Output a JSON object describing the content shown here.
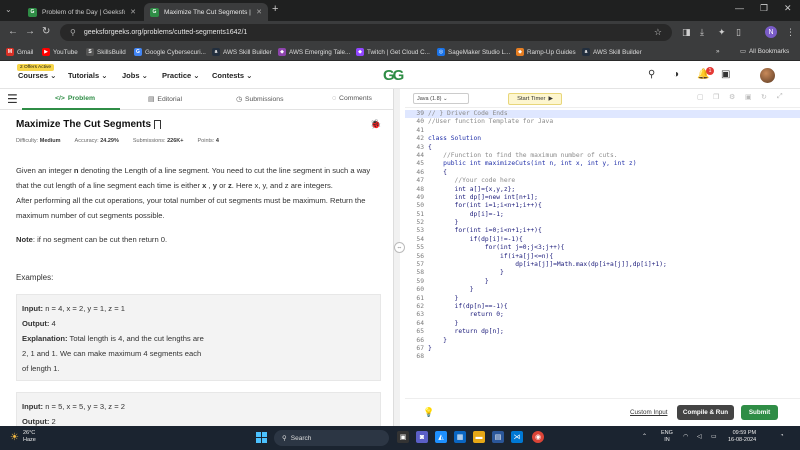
{
  "browser": {
    "tabs": [
      {
        "title": "Problem of the Day | GeeksforGeeks"
      },
      {
        "title": "Maximize The Cut Segments | Pr"
      }
    ],
    "url": "geeksforgeeks.org/problems/cutted-segments1642/1",
    "profile_initial": "N",
    "bookmarks": [
      "Gmail",
      "YouTube",
      "SkillsBuild",
      "Google Cybersecuri...",
      "AWS Skill Builder",
      "AWS Emerging Tale...",
      "Twitch | Get Cloud C...",
      "SageMaker Studio L...",
      "Ramp-Up Guides",
      "AWS Skill Builder"
    ],
    "all_bookmarks": "All Bookmarks"
  },
  "header": {
    "offer": "2 Offers Active",
    "menu": [
      "Courses",
      "Tutorials",
      "Jobs",
      "Practice",
      "Contests"
    ],
    "logo": "GG",
    "notification_count": "1"
  },
  "left": {
    "tabs": [
      "Problem",
      "Editorial",
      "Submissions",
      "Comments"
    ],
    "title": "Maximize The Cut Segments",
    "meta": {
      "difficulty_label": "Difficulty:",
      "difficulty": "Medium",
      "accuracy_label": "Accuracy:",
      "accuracy": "24.29%",
      "submissions_label": "Submissions:",
      "submissions": "226K+",
      "points_label": "Points:",
      "points": "4"
    },
    "desc1_a": "Given an integer ",
    "desc1_n": "n",
    "desc1_b": " denoting the Length of a line segment. You need to cut the line segment in such a way that the cut length of a line segment each time is either ",
    "desc1_x": "x",
    "desc1_c": " , ",
    "desc1_y": "y",
    "desc1_d": " or ",
    "desc1_z": "z",
    "desc1_e": ". Here x, y, and z are integers.",
    "desc2": "After performing all the cut operations, your total number of cut segments must be maximum. Return the maximum number of cut segments possible.",
    "note_label": "Note",
    "note": ": if no segment can be cut then return 0.",
    "examples_label": "Examples:",
    "ex1": {
      "input_label": "Input:",
      "input": " n = 4, x = 2, y = 1, z = 1",
      "output_label": "Output:",
      "output": " 4",
      "expl_label": "Explanation:",
      "expl": " Total length is 4, and the cut lengths are 2, 1 and 1.  We can make maximum 4 segments each of length 1."
    },
    "ex2": {
      "input_label": "Input:",
      "input": " n = 5, x = 5, y = 3, z = 2",
      "output_label": "Output:",
      "output": " 2"
    }
  },
  "right": {
    "language": "Java (1.8)",
    "timer": "Start Timer",
    "code_lines": [
      {
        "n": "39",
        "t": "// } Driver Code Ends"
      },
      {
        "n": "40",
        "t": "//User function Template for Java"
      },
      {
        "n": "41",
        "t": ""
      },
      {
        "n": "42",
        "t": "class Solution"
      },
      {
        "n": "43",
        "t": "{"
      },
      {
        "n": "44",
        "t": "    //Function to find the maximum number of cuts."
      },
      {
        "n": "45",
        "t": "    public int maximizeCuts(int n, int x, int y, int z)"
      },
      {
        "n": "46",
        "t": "    {"
      },
      {
        "n": "47",
        "t": "       //Your code here"
      },
      {
        "n": "48",
        "t": "       int a[]={x,y,z};"
      },
      {
        "n": "49",
        "t": "       int dp[]=new int[n+1];"
      },
      {
        "n": "50",
        "t": "       for(int i=1;i<n+1;i++){"
      },
      {
        "n": "51",
        "t": "           dp[i]=-1;"
      },
      {
        "n": "52",
        "t": "       }"
      },
      {
        "n": "53",
        "t": "       for(int i=0;i<n+1;i++){"
      },
      {
        "n": "54",
        "t": "           if(dp[i]!=-1){"
      },
      {
        "n": "55",
        "t": "               for(int j=0;j<3;j++){"
      },
      {
        "n": "56",
        "t": "                   if(i+a[j]<=n){"
      },
      {
        "n": "57",
        "t": "                       dp[i+a[j]]=Math.max(dp[i+a[j]],dp[i]+1);"
      },
      {
        "n": "58",
        "t": "                   }"
      },
      {
        "n": "59",
        "t": "               }"
      },
      {
        "n": "60",
        "t": "           }"
      },
      {
        "n": "61",
        "t": "       }"
      },
      {
        "n": "62",
        "t": "       if(dp[n]==-1){"
      },
      {
        "n": "63",
        "t": "           return 0;"
      },
      {
        "n": "64",
        "t": "       }"
      },
      {
        "n": "65",
        "t": "       return dp[n];"
      },
      {
        "n": "66",
        "t": "    }"
      },
      {
        "n": "67",
        "t": "}"
      },
      {
        "n": "68",
        "t": ""
      }
    ],
    "custom_input": "Custom Input",
    "compile": "Compile & Run",
    "submit": "Submit"
  },
  "taskbar": {
    "temp": "26°C",
    "weather": "Haze",
    "search": "Search",
    "lang1": "ENG",
    "lang2": "IN",
    "time": "09:59 PM",
    "date": "16-08-2024"
  }
}
